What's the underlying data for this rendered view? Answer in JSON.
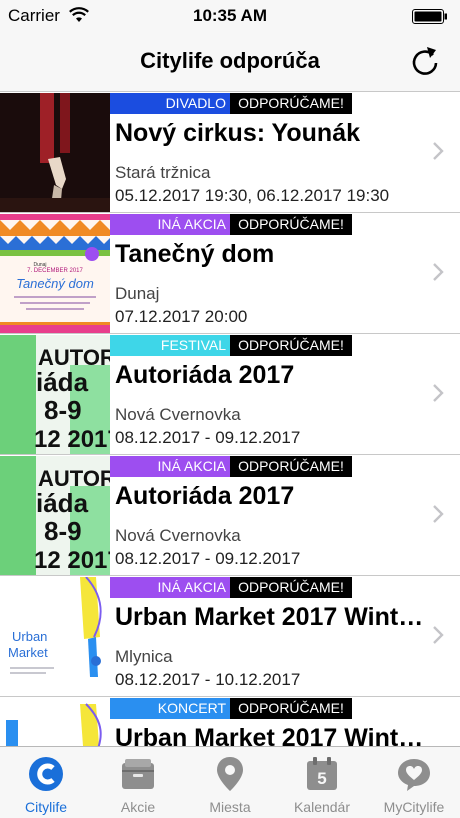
{
  "status_bar": {
    "carrier": "Carrier",
    "time": "10:35 AM"
  },
  "nav": {
    "title": "Citylife odporúča"
  },
  "events": [
    {
      "category": "DIVADLO",
      "category_color": "#1b4de0",
      "badge": "ODPORÚČAME!",
      "title": "Nový cirkus: Younák",
      "venue": "Stará tržnica",
      "date": "05.12.2017 19:30, 06.12.2017 19:30"
    },
    {
      "category": "INÁ AKCIA",
      "category_color": "#9d4ef0",
      "badge": "ODPORÚČAME!",
      "title": "Tanečný dom",
      "venue": "Dunaj",
      "date": "07.12.2017 20:00"
    },
    {
      "category": "FESTIVAL",
      "category_color": "#3ed6e8",
      "badge": "ODPORÚČAME!",
      "title": "Autoriáda 2017",
      "venue": "Nová Cvernovka",
      "date": "08.12.2017 - 09.12.2017"
    },
    {
      "category": "INÁ AKCIA",
      "category_color": "#9d4ef0",
      "badge": "ODPORÚČAME!",
      "title": "Autoriáda 2017",
      "venue": "Nová Cvernovka",
      "date": "08.12.2017 - 09.12.2017"
    },
    {
      "category": "INÁ AKCIA",
      "category_color": "#9d4ef0",
      "badge": "ODPORÚČAME!",
      "title": "Urban Market 2017 Wint…",
      "venue": "Mlynica",
      "date": "08.12.2017 - 10.12.2017"
    },
    {
      "category": "KONCERT",
      "category_color": "#2a8ff0",
      "badge": "ODPORÚČAME!",
      "title": "Urban Market 2017 Wint…",
      "venue": "",
      "date": ""
    }
  ],
  "thumbs": {
    "poster_tanecny": {
      "brand": "Dunaj",
      "date": "7. DECEMBER 2017",
      "title": "Tanečný dom"
    },
    "poster_autoriada": {
      "word": "AUTOR",
      "line2": "iáda",
      "line3": "8-9",
      "line4": "12 2017"
    },
    "poster_urban": {
      "line1": "Urban",
      "line2": "Market"
    }
  },
  "tabs": [
    {
      "label": "Citylife",
      "icon": "citylife-logo-icon",
      "active": true
    },
    {
      "label": "Akcie",
      "icon": "inbox-icon",
      "active": false
    },
    {
      "label": "Miesta",
      "icon": "map-pin-icon",
      "active": false
    },
    {
      "label": "Kalendár",
      "icon": "calendar-icon",
      "active": false,
      "day": "5"
    },
    {
      "label": "MyCitylife",
      "icon": "heart-bubble-icon",
      "active": false
    }
  ],
  "colors": {
    "accent": "#1a6fd9",
    "inactive": "#8e8e8e"
  }
}
